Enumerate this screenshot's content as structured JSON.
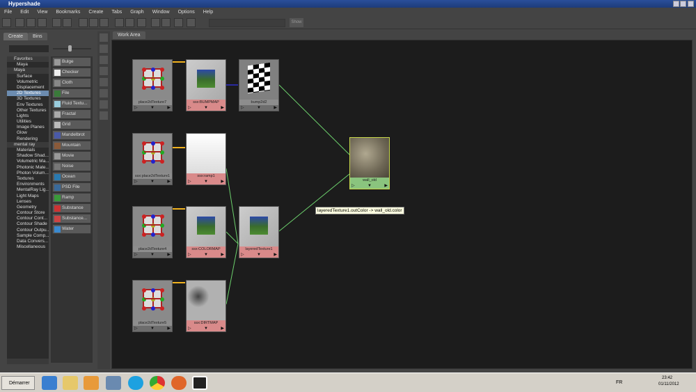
{
  "window": {
    "title": "Hypershade"
  },
  "menu": [
    "File",
    "Edit",
    "View",
    "Bookmarks",
    "Create",
    "Tabs",
    "Graph",
    "Window",
    "Options",
    "Help"
  ],
  "toolbar": {
    "show_label": "Show"
  },
  "left_panel": {
    "tabs": [
      "Create",
      "Bins"
    ],
    "tree": [
      {
        "label": "Favorites",
        "header": true
      },
      {
        "label": "Maya"
      },
      {
        "label": "Maya",
        "header": true
      },
      {
        "label": "Surface"
      },
      {
        "label": "Volumetric"
      },
      {
        "label": "Displacement"
      },
      {
        "label": "2D Textures",
        "selected": true
      },
      {
        "label": "3D Textures"
      },
      {
        "label": "Env Textures"
      },
      {
        "label": "Other Textures"
      },
      {
        "label": "Lights"
      },
      {
        "label": "Utilities"
      },
      {
        "label": "Image Planes"
      },
      {
        "label": "Glow"
      },
      {
        "label": "Rendering"
      },
      {
        "label": "mental ray",
        "header": true
      },
      {
        "label": "Materials"
      },
      {
        "label": "Shadow Shad..."
      },
      {
        "label": "Volumetric Ma..."
      },
      {
        "label": "Photonic Mate..."
      },
      {
        "label": "Photon Volum..."
      },
      {
        "label": "Textures"
      },
      {
        "label": "Environments"
      },
      {
        "label": "MentalRay Lig..."
      },
      {
        "label": "Light Maps"
      },
      {
        "label": "Lenses"
      },
      {
        "label": "Geometry"
      },
      {
        "label": "Contour Store"
      },
      {
        "label": "Contour Cont..."
      },
      {
        "label": "Contour Shade"
      },
      {
        "label": "Contour Outpu..."
      },
      {
        "label": "Sample Comp..."
      },
      {
        "label": "Data Convers..."
      },
      {
        "label": "Miscellaneous"
      }
    ],
    "node_buttons": [
      {
        "label": "Bulge",
        "color": "#999"
      },
      {
        "label": "Checker",
        "color": "#eee"
      },
      {
        "label": "Cloth",
        "color": "#888"
      },
      {
        "label": "File",
        "color": "#3a7a3a"
      },
      {
        "label": "Fluid Textu...",
        "color": "#9cd"
      },
      {
        "label": "Fractal",
        "color": "#aaa"
      },
      {
        "label": "Grid",
        "color": "#bbb"
      },
      {
        "label": "Mandelbrot",
        "color": "#4a5aa8"
      },
      {
        "label": "Mountain",
        "color": "#8a5a3a"
      },
      {
        "label": "Movie",
        "color": "#999"
      },
      {
        "label": "Noise",
        "color": "#777"
      },
      {
        "label": "Ocean",
        "color": "#2a7ab0"
      },
      {
        "label": "PSD File",
        "color": "#3a6a9a"
      },
      {
        "label": "Ramp",
        "color": "#3a9a3a"
      },
      {
        "label": "Substance",
        "color": "#c33"
      },
      {
        "label": "Substance...",
        "color": "#c44"
      },
      {
        "label": "Water",
        "color": "#3a8ad0"
      }
    ]
  },
  "work_area": {
    "tab": "Work Area",
    "nodes": [
      {
        "name": "place2dTexture7",
        "kind": "place"
      },
      {
        "name": "ssx:BUMPMAP",
        "kind": "file"
      },
      {
        "name": "bump2d2",
        "kind": "bump"
      },
      {
        "name": "ssx:place2dTexture1",
        "kind": "place"
      },
      {
        "name": "ssx:ramp1",
        "kind": "ramp"
      },
      {
        "name": "place2dTexture4",
        "kind": "place"
      },
      {
        "name": "ssx:COLORMAP",
        "kind": "file"
      },
      {
        "name": "layeredTexture1",
        "kind": "file"
      },
      {
        "name": "place2dTexture5",
        "kind": "place"
      },
      {
        "name": "ssx:DIRTMAP",
        "kind": "dirt"
      },
      {
        "name": "wall_old",
        "kind": "shader"
      }
    ],
    "tooltip": "layeredTexture1.outColor -> wall_old.color"
  },
  "taskbar": {
    "start": "Démarrer",
    "lang": "FR",
    "time": "23:42",
    "date": "01/11/2012"
  }
}
